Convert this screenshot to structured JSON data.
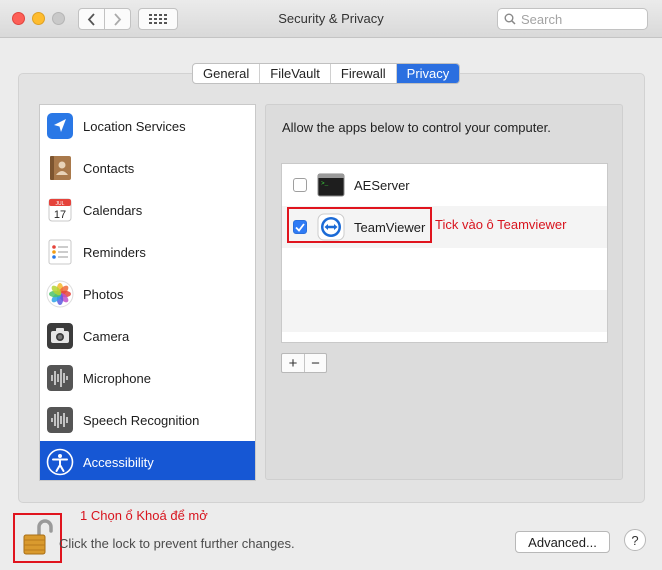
{
  "window": {
    "title": "Security & Privacy",
    "search_placeholder": "Search"
  },
  "tabs": [
    {
      "label": "General",
      "active": false
    },
    {
      "label": "FileVault",
      "active": false
    },
    {
      "label": "Firewall",
      "active": false
    },
    {
      "label": "Privacy",
      "active": true
    }
  ],
  "sidebar": {
    "items": [
      {
        "label": "Location Services",
        "icon": "location-arrow-icon",
        "active": false
      },
      {
        "label": "Contacts",
        "icon": "contacts-book-icon",
        "active": false
      },
      {
        "label": "Calendars",
        "icon": "calendar-icon",
        "active": false
      },
      {
        "label": "Reminders",
        "icon": "reminders-list-icon",
        "active": false
      },
      {
        "label": "Photos",
        "icon": "photos-flower-icon",
        "active": false
      },
      {
        "label": "Camera",
        "icon": "camera-icon",
        "active": false
      },
      {
        "label": "Microphone",
        "icon": "microphone-waveform-icon",
        "active": false
      },
      {
        "label": "Speech Recognition",
        "icon": "speech-waveform-icon",
        "active": false
      },
      {
        "label": "Accessibility",
        "icon": "accessibility-person-icon",
        "active": true
      }
    ],
    "calendar_icon": {
      "month": "JUL",
      "day": "17"
    }
  },
  "main": {
    "instructions": "Allow the apps below to control your computer.",
    "apps": [
      {
        "name": "AEServer",
        "checked": false,
        "icon": "terminal-app-icon"
      },
      {
        "name": "TeamViewer",
        "checked": true,
        "icon": "teamviewer-app-icon"
      }
    ],
    "add_label": "+",
    "remove_label": "−"
  },
  "annotations": {
    "teamviewer_note": "Tick vào ô Teamviewer",
    "lock_note": "1 Chọn ổ Khoá để mở"
  },
  "footer": {
    "lock_text": "Click the lock to prevent further changes.",
    "advanced_label": "Advanced...",
    "help_label": "?"
  },
  "colors": {
    "accent": "#1657d4",
    "annotation": "#e0141e"
  }
}
